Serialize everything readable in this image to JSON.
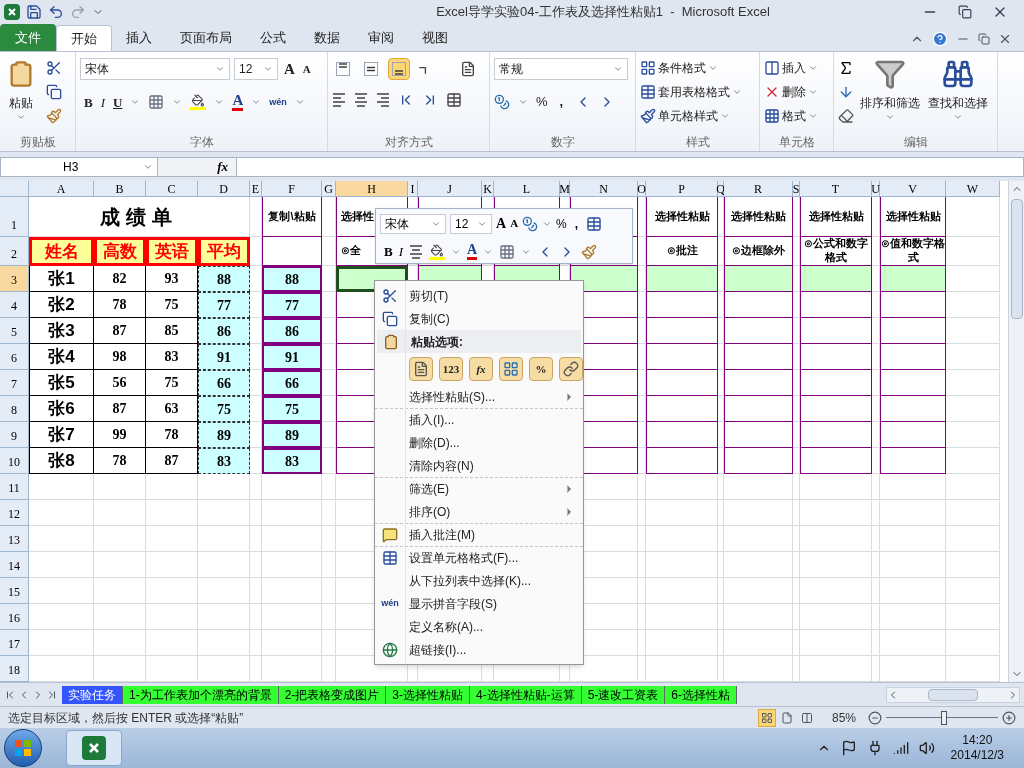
{
  "window": {
    "title": "Excel导学实验04-工作表及选择性粘贴1  -  Microsoft Excel"
  },
  "ribbon_tabs": [
    {
      "label": "文件",
      "kind": "file",
      "selected": false
    },
    {
      "label": "开始",
      "kind": "tab",
      "selected": true
    },
    {
      "label": "插入",
      "kind": "tab",
      "selected": false
    },
    {
      "label": "页面布局",
      "kind": "tab",
      "selected": false
    },
    {
      "label": "公式",
      "kind": "tab",
      "selected": false
    },
    {
      "label": "数据",
      "kind": "tab",
      "selected": false
    },
    {
      "label": "审阅",
      "kind": "tab",
      "selected": false
    },
    {
      "label": "视图",
      "kind": "tab",
      "selected": false
    }
  ],
  "clipboard": {
    "paste": "粘贴",
    "label": "剪贴板"
  },
  "font": {
    "name": "宋体",
    "size": "12",
    "grow": "A",
    "shrink": "A",
    "bold": "B",
    "italic": "I",
    "underline": "U",
    "font_color": "A",
    "phonetic": "wén",
    "label": "字体"
  },
  "alignment": {
    "vertical": [
      {
        "selected": false
      },
      {
        "selected": false
      },
      {
        "selected": true
      }
    ],
    "label": "对齐方式"
  },
  "number": {
    "format": "常规",
    "percent": "%",
    "comma": ",",
    "label": "数字"
  },
  "styles": {
    "items": [
      "条件格式",
      "套用表格格式",
      "单元格样式"
    ],
    "label": "样式"
  },
  "cells": {
    "items": [
      "插入",
      "删除",
      "格式"
    ],
    "label": "单元格"
  },
  "editing": {
    "items": [
      "排序和筛选",
      "查找和选择"
    ],
    "label": "编辑"
  },
  "formula_bar": {
    "name_box": "H3",
    "fx": "fx"
  },
  "columns": [
    {
      "label": "A",
      "selected": false
    },
    {
      "label": "B",
      "selected": false
    },
    {
      "label": "C",
      "selected": false
    },
    {
      "label": "D",
      "selected": false
    },
    {
      "label": "E",
      "selected": false
    },
    {
      "label": "F",
      "selected": false
    },
    {
      "label": "G",
      "selected": false
    },
    {
      "label": "H",
      "selected": true
    },
    {
      "label": "I",
      "selected": false
    },
    {
      "label": "J",
      "selected": false
    },
    {
      "label": "K",
      "selected": false
    },
    {
      "label": "L",
      "selected": false
    },
    {
      "label": "M",
      "selected": false
    },
    {
      "label": "N",
      "selected": false
    },
    {
      "label": "O",
      "selected": false
    },
    {
      "label": "P",
      "selected": false
    },
    {
      "label": "Q",
      "selected": false
    },
    {
      "label": "R",
      "selected": false
    },
    {
      "label": "S",
      "selected": false
    },
    {
      "label": "T",
      "selected": false
    },
    {
      "label": "U",
      "selected": false
    },
    {
      "label": "V",
      "selected": false
    },
    {
      "label": "W",
      "selected": false
    }
  ],
  "rows": [
    {
      "label": "1",
      "selected": false
    },
    {
      "label": "2",
      "selected": false
    },
    {
      "label": "3",
      "selected": true
    },
    {
      "label": "4",
      "selected": false
    },
    {
      "label": "5",
      "selected": false
    },
    {
      "label": "6",
      "selected": false
    },
    {
      "label": "7",
      "selected": false
    },
    {
      "label": "8",
      "selected": false
    },
    {
      "label": "9",
      "selected": false
    },
    {
      "label": "10",
      "selected": false
    },
    {
      "label": "11",
      "selected": false
    },
    {
      "label": "12",
      "selected": false
    },
    {
      "label": "13",
      "selected": false
    },
    {
      "label": "14",
      "selected": false
    },
    {
      "label": "15",
      "selected": false
    },
    {
      "label": "16",
      "selected": false
    },
    {
      "label": "17",
      "selected": false
    },
    {
      "label": "18",
      "selected": false
    }
  ],
  "score_table": {
    "title": "成绩单",
    "header": [
      "姓名",
      "高数",
      "英语",
      "平均"
    ],
    "rows": [
      [
        "张1",
        "82",
        "93",
        "88"
      ],
      [
        "张2",
        "78",
        "75",
        "77"
      ],
      [
        "张3",
        "87",
        "85",
        "86"
      ],
      [
        "张4",
        "98",
        "83",
        "91"
      ],
      [
        "张5",
        "56",
        "75",
        "66"
      ],
      [
        "张6",
        "87",
        "63",
        "75"
      ],
      [
        "张7",
        "99",
        "78",
        "89"
      ],
      [
        "张8",
        "78",
        "87",
        "83"
      ]
    ]
  },
  "copy_paste": {
    "title": "复制\\粘贴",
    "values": [
      "88",
      "77",
      "86",
      "91",
      "66",
      "75",
      "89",
      "83"
    ]
  },
  "paste_columns": [
    {
      "title": "选择性",
      "option": "⊙全"
    },
    {},
    {},
    {},
    {
      "title": "选择性粘贴",
      "option": "⊙批注"
    },
    {
      "title": "选择性粘贴",
      "option": "⊙边框除外"
    },
    {
      "title": "选择性粘贴",
      "option": "⊙公式和数字格式"
    },
    {
      "title": "选择性粘贴",
      "option": "⊙值和数字格式"
    }
  ],
  "mini_toolbar": {
    "font": "宋体",
    "size": "12",
    "grow": "A",
    "shrink": "A",
    "percent": "%",
    "comma": ",",
    "bold": "B",
    "italic": "I",
    "font_color": "A"
  },
  "context_menu": [
    {
      "kind": "item",
      "label": "剪切(T)"
    },
    {
      "kind": "item",
      "label": "复制(C)"
    },
    {
      "kind": "header",
      "label": "粘贴选项:"
    },
    {
      "kind": "paste_icons",
      "icons": [
        {
          "kind": "paste"
        },
        {
          "kind": "values",
          "label": "123"
        },
        {
          "kind": "formulas",
          "label": "fx"
        },
        {
          "kind": "transpose"
        },
        {
          "kind": "formatting",
          "label": "%"
        },
        {
          "kind": "link"
        }
      ]
    },
    {
      "kind": "item",
      "label": "选择性粘贴(S)...",
      "submenu": true
    },
    {
      "kind": "item",
      "label": "插入(I)...",
      "group_start": true
    },
    {
      "kind": "item",
      "label": "删除(D)..."
    },
    {
      "kind": "item",
      "label": "清除内容(N)"
    },
    {
      "kind": "item",
      "label": "筛选(E)",
      "submenu": true,
      "group_start": true
    },
    {
      "kind": "item",
      "label": "排序(O)",
      "submenu": true
    },
    {
      "kind": "item",
      "label": "插入批注(M)",
      "group_start": true
    },
    {
      "kind": "item",
      "label": "设置单元格格式(F)...",
      "group_start": true
    },
    {
      "kind": "item",
      "label": "从下拉列表中选择(K)..."
    },
    {
      "kind": "item",
      "icon_text": "wén",
      "label": "显示拼音字段(S)"
    },
    {
      "kind": "item",
      "label": "定义名称(A)..."
    },
    {
      "kind": "item",
      "label": "超链接(I)..."
    }
  ],
  "sheet_tabs": [
    {
      "label": "实验任务",
      "color": "#3355ff"
    },
    {
      "label": "1-为工作表加个漂亮的背景",
      "color": "#33ff33"
    },
    {
      "label": "2-把表格变成图片",
      "color": "#33ff33"
    },
    {
      "label": "3-选择性粘贴",
      "color": "#33ff33"
    },
    {
      "label": "4-选择性粘贴-运算",
      "color": "#33ff33"
    },
    {
      "label": "5-速改工资表",
      "color": "#33ff33"
    },
    {
      "label": "6-选择性粘",
      "color": "#33ff33"
    }
  ],
  "status_bar": {
    "message": "选定目标区域，然后按 ENTER 或选择“粘贴”",
    "views": [
      {
        "selected": true
      },
      {
        "selected": false
      },
      {
        "selected": false
      }
    ],
    "zoom": "85%",
    "zoom_slider": {
      "level": 0.52
    }
  },
  "taskbar": {
    "time": "14:20",
    "date": "2014/12/3"
  }
}
